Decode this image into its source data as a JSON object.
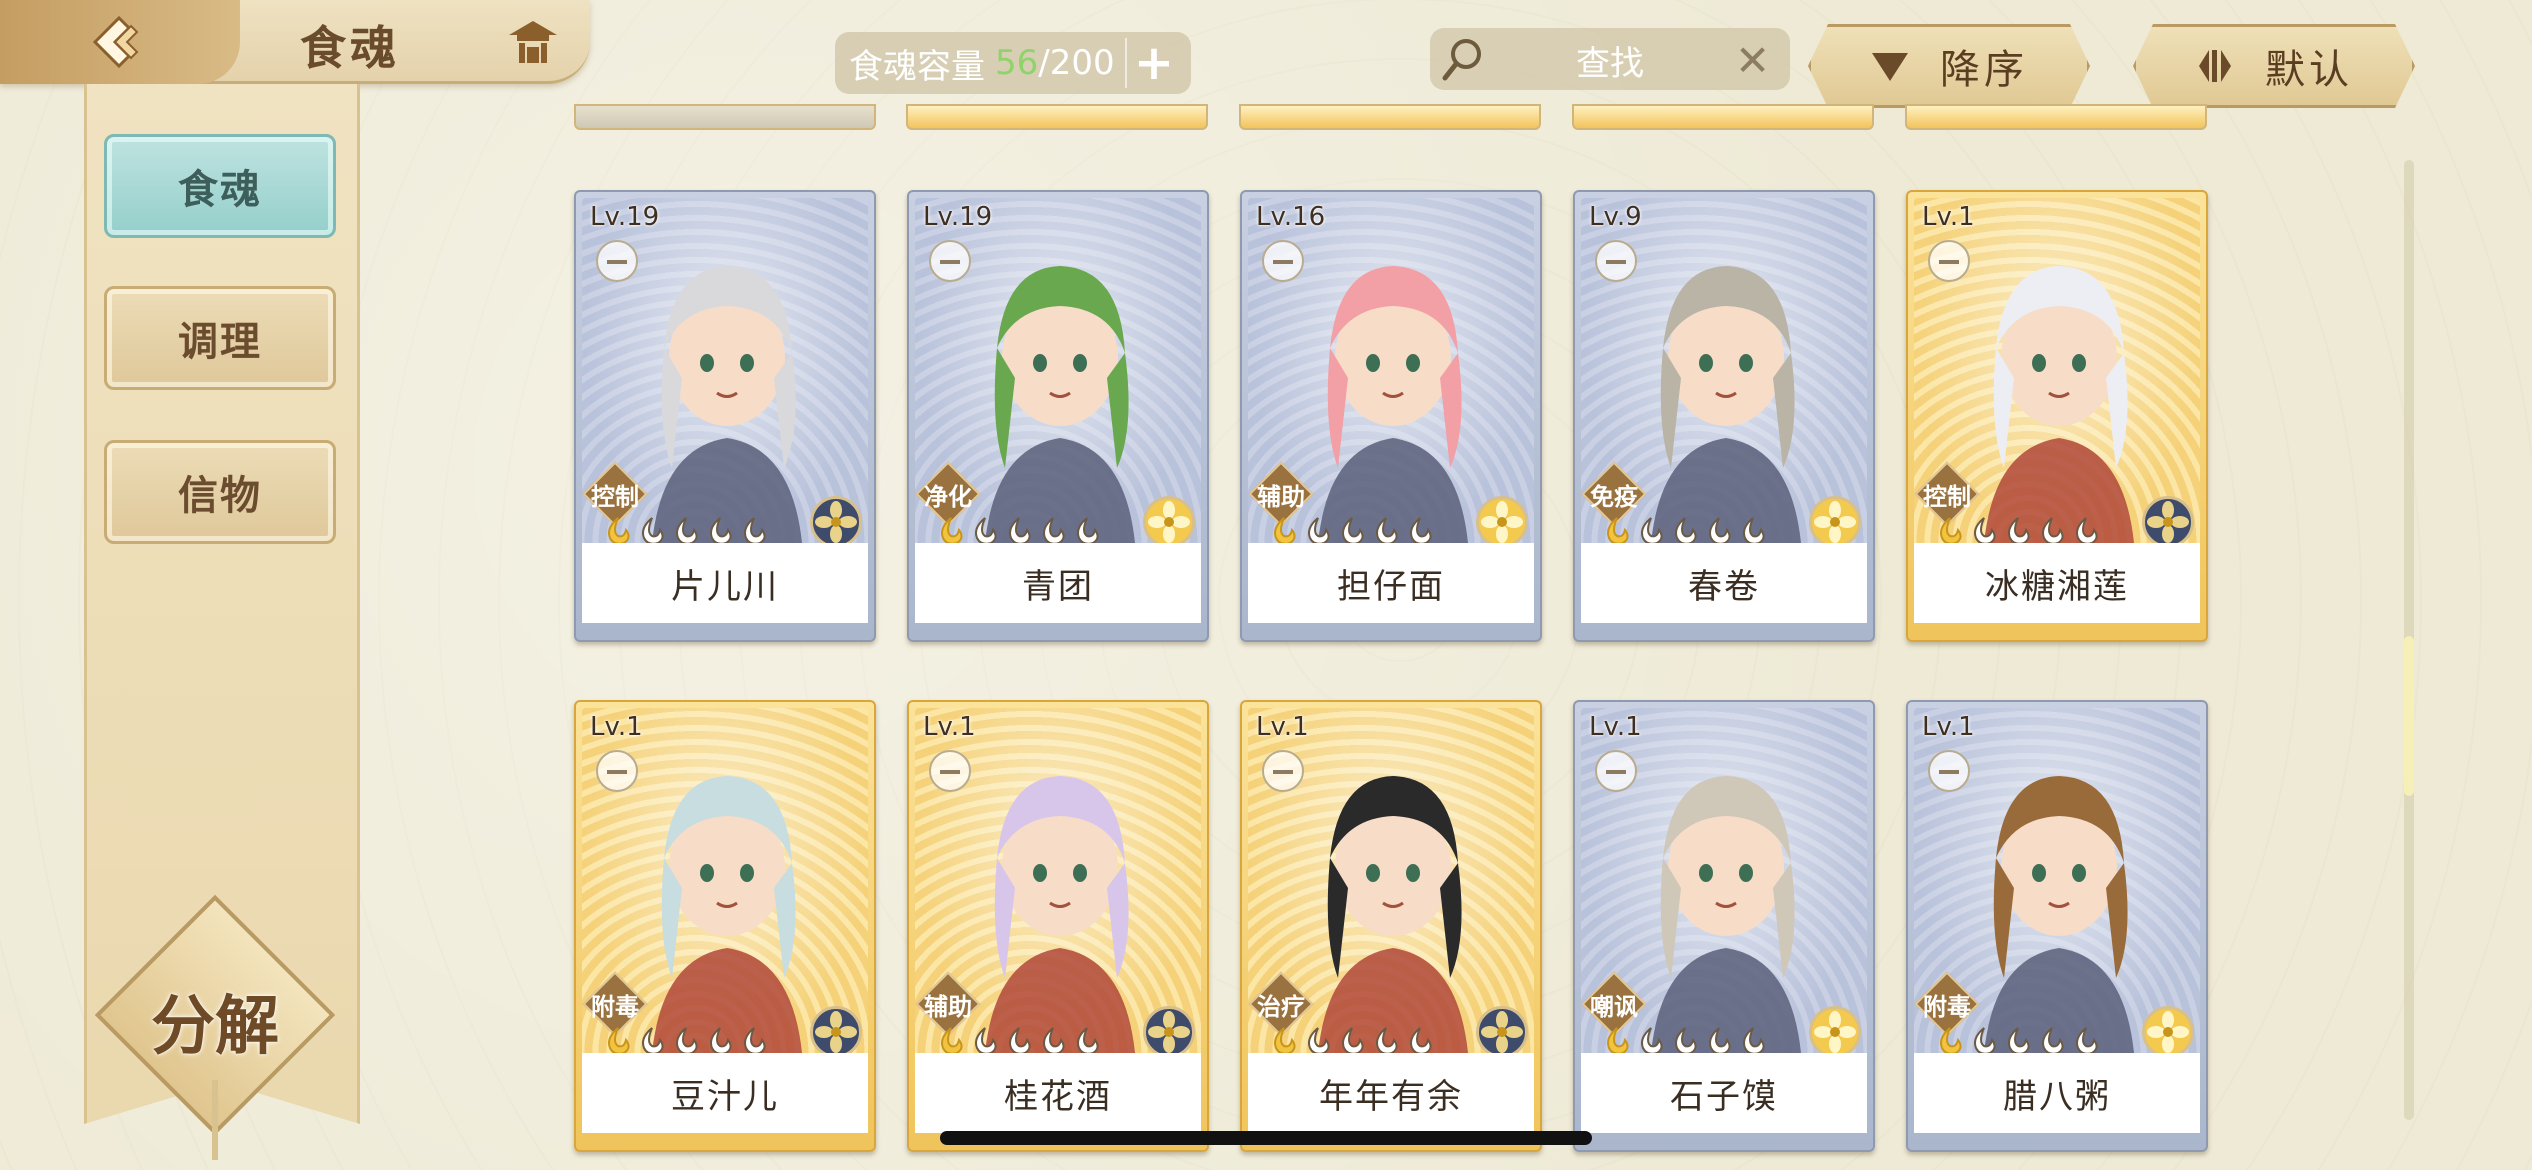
{
  "header": {
    "title": "食魂",
    "back_icon": "back-arrow-icon",
    "home_icon": "pavilion-icon"
  },
  "capacity": {
    "label": "食魂容量",
    "current": "56",
    "separator": "/",
    "max": "200",
    "add_label": "+"
  },
  "search": {
    "placeholder": "查找",
    "clear_label": "✕"
  },
  "sort": {
    "order_label": "降序",
    "default_label": "默认"
  },
  "sidebar": {
    "items": [
      {
        "label": "食魂",
        "active": true
      },
      {
        "label": "调理",
        "active": false
      },
      {
        "label": "信物",
        "active": false
      }
    ],
    "decompose_label": "分解"
  },
  "cards": [
    {
      "level": "Lv.19",
      "name": "片儿川",
      "role": "控制",
      "frame": "blue",
      "element": "dark",
      "stars_filled": 1,
      "stars_total": 5
    },
    {
      "level": "Lv.19",
      "name": "青团",
      "role": "净化",
      "frame": "blue",
      "element": "gold",
      "stars_filled": 1,
      "stars_total": 5
    },
    {
      "level": "Lv.16",
      "name": "担仔面",
      "role": "辅助",
      "frame": "blue",
      "element": "gold",
      "stars_filled": 1,
      "stars_total": 5
    },
    {
      "level": "Lv.9",
      "name": "春卷",
      "role": "免疫",
      "frame": "blue",
      "element": "gold",
      "stars_filled": 1,
      "stars_total": 5
    },
    {
      "level": "Lv.1",
      "name": "冰糖湘莲",
      "role": "控制",
      "frame": "gold",
      "element": "dark",
      "stars_filled": 1,
      "stars_total": 5
    },
    {
      "level": "Lv.1",
      "name": "豆汁儿",
      "role": "附毒",
      "frame": "gold",
      "element": "dark",
      "stars_filled": 1,
      "stars_total": 5
    },
    {
      "level": "Lv.1",
      "name": "桂花酒",
      "role": "辅助",
      "frame": "gold",
      "element": "dark",
      "stars_filled": 1,
      "stars_total": 5
    },
    {
      "level": "Lv.1",
      "name": "年年有余",
      "role": "治疗",
      "frame": "gold",
      "element": "dark",
      "stars_filled": 1,
      "stars_total": 5
    },
    {
      "level": "Lv.1",
      "name": "石子馍",
      "role": "嘲讽",
      "frame": "blue",
      "element": "gold",
      "stars_filled": 1,
      "stars_total": 5
    },
    {
      "level": "Lv.1",
      "name": "腊八粥",
      "role": "附毒",
      "frame": "blue",
      "element": "gold",
      "stars_filled": 1,
      "stars_total": 5
    }
  ],
  "colors": {
    "capacity_current": "#8fd36b",
    "frame_blue": "#aab6cc",
    "frame_gold": "#f0c45b",
    "sidebar_active": "#94cfcb"
  },
  "scroll": {
    "position_fraction": 0.5
  }
}
